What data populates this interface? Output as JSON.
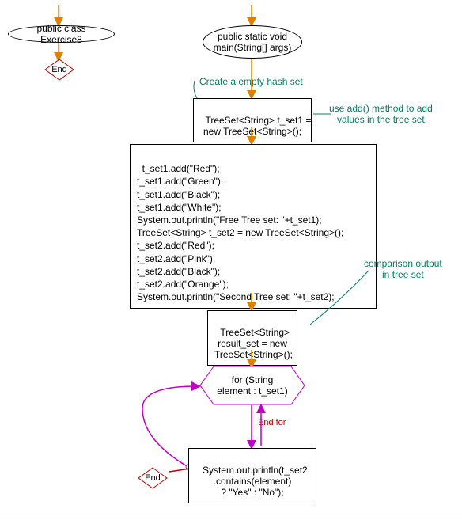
{
  "left": {
    "class_decl": "public class Exercise8",
    "end": "End"
  },
  "main": {
    "method_decl": "public static void\nmain(String[] args)",
    "ann_create": "Create a empty hash set",
    "stmt_new_set1": "TreeSet<String> t_set1 =\nnew TreeSet<String>();",
    "ann_add": "use add() method to add\nvalues in the tree set",
    "stmt_block": "t_set1.add(\"Red\");\nt_set1.add(\"Green\");\nt_set1.add(\"Black\");\nt_set1.add(\"White\");\nSystem.out.println(\"Free Tree set: \"+t_set1);\nTreeSet<String> t_set2 = new TreeSet<String>();\nt_set2.add(\"Red\");\nt_set2.add(\"Pink\");\nt_set2.add(\"Black\");\nt_set2.add(\"Orange\");\nSystem.out.println(\"Second Tree set: \"+t_set2);",
    "stmt_result_set": "TreeSet<String>\nresult_set = new\nTreeSet<String>();",
    "ann_compare": "comparison output\nin tree set",
    "loop_header": "for (String\nelement : t_set1)",
    "loop_end_label": "End for",
    "stmt_print": "System.out.println(t_set2\n.contains(element)\n? \"Yes\" : \"No\");",
    "end": "End"
  }
}
